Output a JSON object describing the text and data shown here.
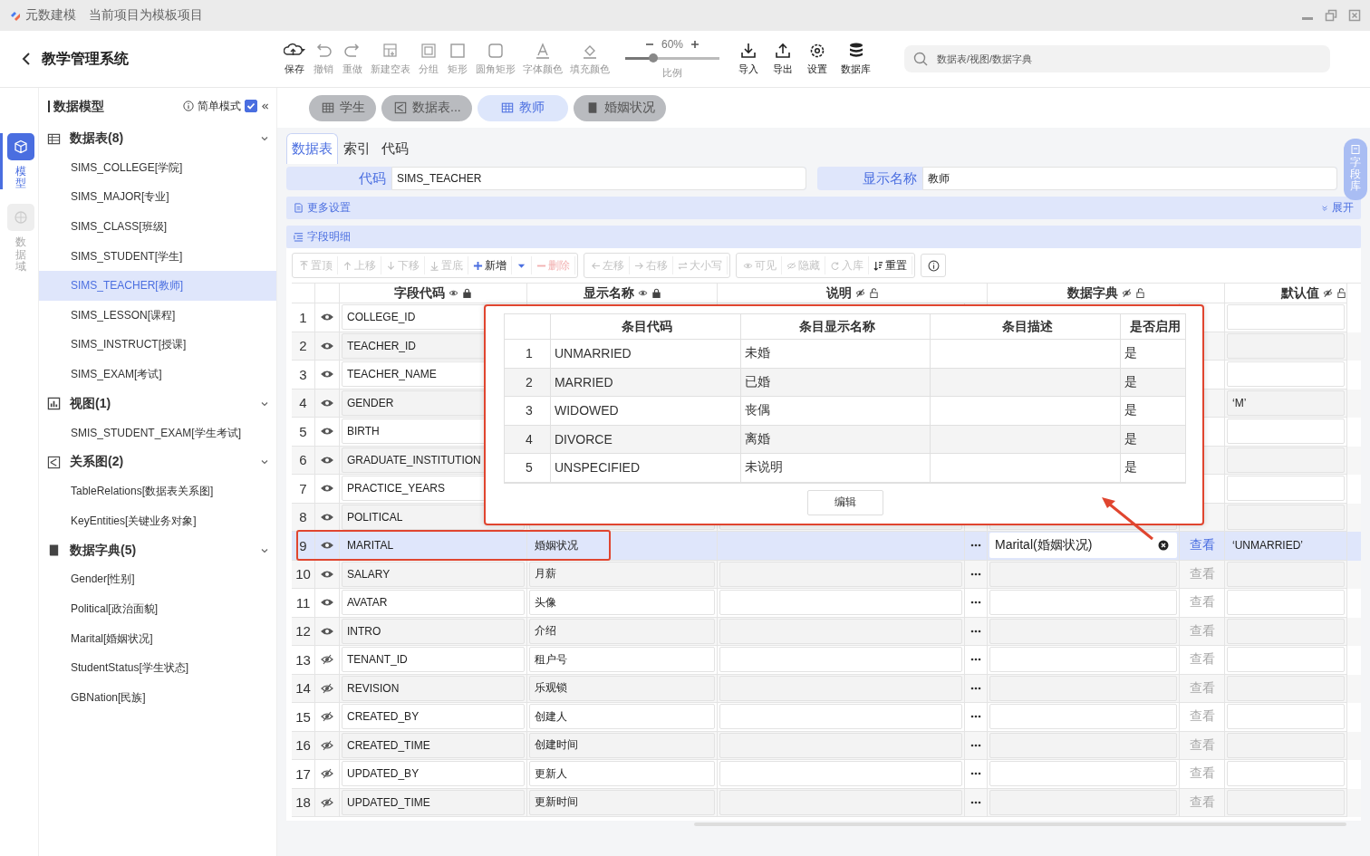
{
  "title_bar": {
    "app_name": "元数建模",
    "project_note": "当前项目为模板项目"
  },
  "header": {
    "project_title": "教学管理系统",
    "tools": [
      {
        "kind": "save",
        "label": "保存",
        "disabled": false
      },
      {
        "kind": "undo",
        "label": "撤销",
        "disabled": true
      },
      {
        "kind": "redo",
        "label": "重做",
        "disabled": true
      },
      {
        "kind": "new-table",
        "label": "新建空表",
        "disabled": true
      },
      {
        "kind": "group",
        "label": "分组",
        "disabled": true
      },
      {
        "kind": "rect",
        "label": "矩形",
        "disabled": true
      },
      {
        "kind": "round-rect",
        "label": "圆角矩形",
        "disabled": true
      },
      {
        "kind": "font-color",
        "label": "字体颜色",
        "disabled": true
      },
      {
        "kind": "fill-color",
        "label": "填充颜色",
        "disabled": true
      }
    ],
    "zoom": {
      "value": "60%",
      "label": "比例",
      "level": 0.3
    },
    "tools_right": [
      {
        "kind": "import",
        "label": "导入",
        "disabled": false
      },
      {
        "kind": "export",
        "label": "导出",
        "disabled": false
      },
      {
        "kind": "settings",
        "label": "设置",
        "disabled": false
      },
      {
        "kind": "database",
        "label": "数据库",
        "disabled": false
      }
    ],
    "search": {
      "placeholder": "数据表/视图/数据字典"
    }
  },
  "rail": [
    {
      "kind": "model",
      "label": "模型",
      "selected": true
    },
    {
      "kind": "domain",
      "label": "数据域",
      "selected": false
    }
  ],
  "sidebar": {
    "title": "数据模型",
    "simple_mode": {
      "label": "简单模式",
      "checked": true
    },
    "groups": [
      {
        "kind": "table",
        "label": "数据表(8)",
        "expanded": true,
        "children": [
          {
            "label": "SIMS_COLLEGE[学院]",
            "selected": false
          },
          {
            "label": "SIMS_MAJOR[专业]",
            "selected": false
          },
          {
            "label": "SIMS_CLASS[班级]",
            "selected": false
          },
          {
            "label": "SIMS_STUDENT[学生]",
            "selected": false
          },
          {
            "label": "SIMS_TEACHER[教师]",
            "selected": true
          },
          {
            "label": "SIMS_LESSON[课程]",
            "selected": false
          },
          {
            "label": "SIMS_INSTRUCT[授课]",
            "selected": false
          },
          {
            "label": "SIMS_EXAM[考试]",
            "selected": false
          }
        ]
      },
      {
        "kind": "view",
        "label": "视图(1)",
        "expanded": true,
        "children": [
          {
            "label": "SMIS_STUDENT_EXAM[学生考试]",
            "selected": false
          }
        ]
      },
      {
        "kind": "relation",
        "label": "关系图(2)",
        "expanded": true,
        "children": [
          {
            "label": "TableRelations[数据表关系图]",
            "selected": false
          },
          {
            "label": "KeyEntities[关键业务对象]",
            "selected": false
          }
        ]
      },
      {
        "kind": "dict",
        "label": "数据字典(5)",
        "expanded": true,
        "children": [
          {
            "label": "Gender[性别]",
            "selected": false
          },
          {
            "label": "Political[政治面貌]",
            "selected": false
          },
          {
            "label": "Marital[婚姻状况]",
            "selected": false
          },
          {
            "label": "StudentStatus[学生状态]",
            "selected": false
          },
          {
            "label": "GBNation[民族]",
            "selected": false
          }
        ]
      }
    ]
  },
  "open_tabs": [
    {
      "kind": "table",
      "label": "学生",
      "selected": false
    },
    {
      "kind": "relation",
      "label": "数据表...",
      "selected": false
    },
    {
      "kind": "table",
      "label": "教师",
      "selected": true
    },
    {
      "kind": "dict",
      "label": "婚姻状况",
      "selected": false
    }
  ],
  "editor": {
    "tabs": [
      {
        "label": "数据表",
        "selected": true
      },
      {
        "label": "索引",
        "selected": false
      },
      {
        "label": "代码",
        "selected": false
      }
    ],
    "code": {
      "label": "代码",
      "value": "SIMS_TEACHER"
    },
    "display_name": {
      "label": "显示名称",
      "value": "教师"
    },
    "more_settings": {
      "label": "更多设置",
      "toggle": "展开"
    },
    "fields_section": "字段明细",
    "side_tab": "字段库",
    "tool_groups": [
      {
        "items": [
          {
            "kind": "top",
            "label": "置顶",
            "disabled": true
          },
          {
            "kind": "up",
            "label": "上移",
            "disabled": true
          },
          {
            "kind": "down",
            "label": "下移",
            "disabled": true
          },
          {
            "kind": "bottom",
            "label": "置底",
            "disabled": true
          },
          {
            "kind": "add",
            "label": "新增",
            "disabled": false
          },
          {
            "kind": "dropdown",
            "disabled": false
          },
          {
            "kind": "delete",
            "label": "删除",
            "disabled": true
          }
        ]
      },
      {
        "items": [
          {
            "kind": "left",
            "label": "左移",
            "disabled": true
          },
          {
            "kind": "right",
            "label": "右移",
            "disabled": true
          },
          {
            "kind": "case",
            "label": "大小写",
            "disabled": true
          }
        ]
      },
      {
        "items": [
          {
            "kind": "visible",
            "label": "可见",
            "disabled": true
          },
          {
            "kind": "hidden",
            "label": "隐藏",
            "disabled": true
          },
          {
            "kind": "store",
            "label": "入库",
            "disabled": true
          },
          {
            "kind": "reset",
            "label": "重置",
            "disabled": false
          }
        ]
      }
    ]
  },
  "table": {
    "columns": [
      {
        "label": "字段代码",
        "visible": true,
        "locked": true
      },
      {
        "label": "显示名称",
        "visible": true,
        "locked": true
      },
      {
        "label": "说明",
        "visible": false,
        "locked": false
      },
      {
        "label": "数据字典",
        "visible": false,
        "locked": false
      },
      {
        "label": "默认值",
        "visible": false,
        "locked": false
      }
    ],
    "rows": [
      {
        "index": "1",
        "visible": true,
        "code": "COLLEGE_ID",
        "selected": false
      },
      {
        "index": "2",
        "visible": true,
        "code": "TEACHER_ID",
        "selected": false
      },
      {
        "index": "3",
        "visible": true,
        "code": "TEACHER_NAME",
        "selected": false
      },
      {
        "index": "4",
        "visible": true,
        "code": "GENDER",
        "selected": false,
        "default": "‘M’"
      },
      {
        "index": "5",
        "visible": true,
        "code": "BIRTH",
        "selected": false
      },
      {
        "index": "6",
        "visible": true,
        "code": "GRADUATE_INSTITUTION",
        "selected": false
      },
      {
        "index": "7",
        "visible": true,
        "code": "PRACTICE_YEARS",
        "selected": false
      },
      {
        "index": "8",
        "visible": true,
        "code": "POLITICAL",
        "selected": false
      },
      {
        "index": "9",
        "visible": true,
        "code": "MARITAL",
        "name": "婚姻状况",
        "dict": "Marital(婚姻状况)",
        "view": {
          "label": "查看",
          "disabled": false
        },
        "default": "‘UNMARRIED’",
        "selected": true
      },
      {
        "index": "10",
        "visible": true,
        "code": "SALARY",
        "name": "月薪",
        "view": {
          "label": "查看",
          "disabled": true
        },
        "selected": false
      },
      {
        "index": "11",
        "visible": true,
        "code": "AVATAR",
        "name": "头像",
        "view": {
          "label": "查看",
          "disabled": true
        },
        "selected": false
      },
      {
        "index": "12",
        "visible": true,
        "code": "INTRO",
        "name": "介绍",
        "view": {
          "label": "查看",
          "disabled": true
        },
        "selected": false
      },
      {
        "index": "13",
        "visible": false,
        "code": "TENANT_ID",
        "name": "租户号",
        "view": {
          "label": "查看",
          "disabled": true
        },
        "selected": false
      },
      {
        "index": "14",
        "visible": false,
        "code": "REVISION",
        "name": "乐观锁",
        "view": {
          "label": "查看",
          "disabled": true
        },
        "selected": false
      },
      {
        "index": "15",
        "visible": false,
        "code": "CREATED_BY",
        "name": "创建人",
        "view": {
          "label": "查看",
          "disabled": true
        },
        "selected": false
      },
      {
        "index": "16",
        "visible": false,
        "code": "CREATED_TIME",
        "name": "创建时间",
        "view": {
          "label": "查看",
          "disabled": true
        },
        "selected": false
      },
      {
        "index": "17",
        "visible": false,
        "code": "UPDATED_BY",
        "name": "更新人",
        "view": {
          "label": "查看",
          "disabled": true
        },
        "selected": false
      },
      {
        "index": "18",
        "visible": false,
        "code": "UPDATED_TIME",
        "name": "更新时间",
        "view": {
          "label": "查看",
          "disabled": true
        },
        "selected": false
      }
    ]
  },
  "dict_popup": {
    "columns": [
      "条目代码",
      "条目显示名称",
      "条目描述",
      "是否启用"
    ],
    "rows": [
      {
        "index": "1",
        "code": "UNMARRIED",
        "name": "未婚",
        "enabled": "是"
      },
      {
        "index": "2",
        "code": "MARRIED",
        "name": "已婚",
        "enabled": "是"
      },
      {
        "index": "3",
        "code": "WIDOWED",
        "name": "丧偶",
        "enabled": "是"
      },
      {
        "index": "4",
        "code": "DIVORCE",
        "name": "离婚",
        "enabled": "是"
      },
      {
        "index": "5",
        "code": "UNSPECIFIED",
        "name": "未说明",
        "enabled": "是"
      }
    ],
    "edit_button": "编辑"
  }
}
